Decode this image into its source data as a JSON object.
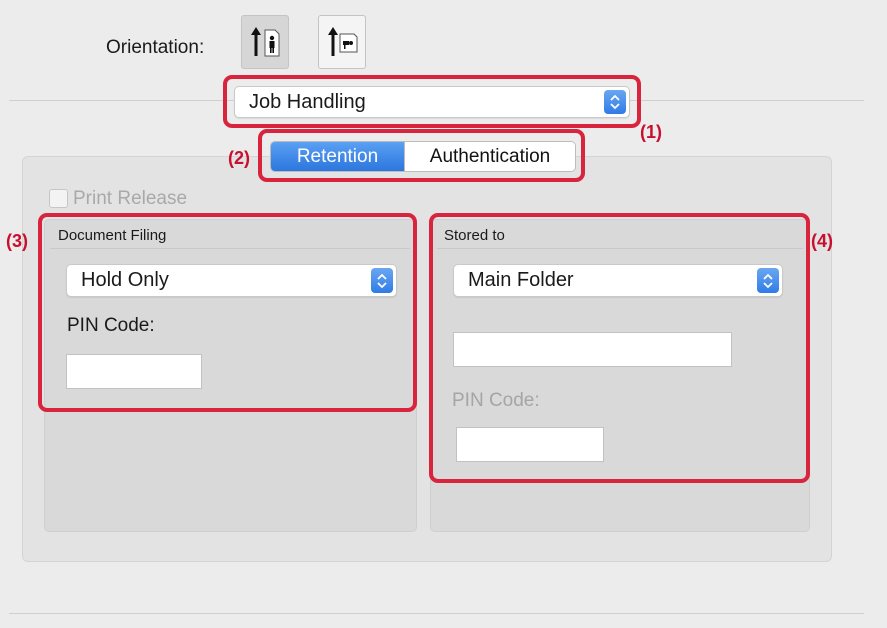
{
  "orientation": {
    "label": "Orientation:",
    "portrait_icon": "portrait-orientation-icon",
    "landscape_icon": "landscape-orientation-icon",
    "selected": "portrait"
  },
  "panel_menu": {
    "value": "Job Handling"
  },
  "tabs": [
    {
      "label": "Retention",
      "active": true
    },
    {
      "label": "Authentication",
      "active": false
    }
  ],
  "print_release": {
    "label": "Print Release",
    "checked": false,
    "enabled": false
  },
  "document_filing": {
    "title": "Document Filing",
    "mode_value": "Hold Only",
    "pin_label": "PIN Code:",
    "pin_value": ""
  },
  "stored_to": {
    "title": "Stored to",
    "folder_value": "Main Folder",
    "folder_name_value": "",
    "pin_label": "PIN Code:",
    "pin_value": ""
  },
  "callouts": {
    "c1": "(1)",
    "c2": "(2)",
    "c3": "(3)",
    "c4": "(4)"
  },
  "colors": {
    "highlight_red": "#d8243c",
    "callout_red": "#c8102e",
    "accent_blue": "#2c76de"
  }
}
